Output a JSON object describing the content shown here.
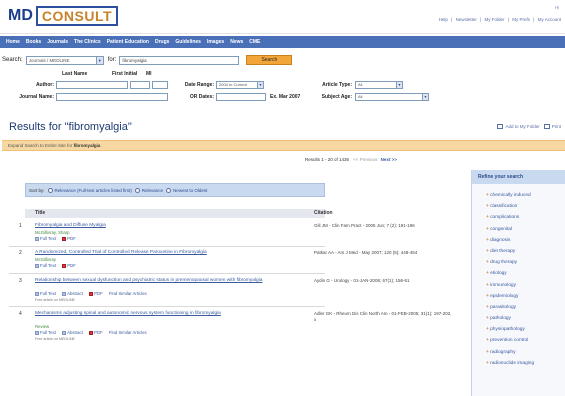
{
  "app": {
    "logo_md": "MD",
    "logo_consult": "CONSULT"
  },
  "header": {
    "hide": "Hi",
    "toplinks": [
      "Help",
      "|",
      "Newsletter",
      "|",
      "My Folder",
      "|",
      "My Prefs",
      "|",
      "My Account"
    ]
  },
  "navbar": {
    "items": [
      "Home",
      "Books",
      "Journals",
      "The Clinics",
      "Patient Education",
      "Drugs",
      "Guidelines",
      "Images",
      "News",
      "CME"
    ]
  },
  "search": {
    "label": "Search:",
    "scope": "Journals / MEDLINE",
    "for_label": "for:",
    "query": "fibromyalgia",
    "button": "Search"
  },
  "advanced": {
    "last_name": "Last Name",
    "first_initial": "First Initial",
    "mi": "MI",
    "author": "Author:",
    "journal_name": "Journal Name:",
    "date_range": "Date Range:",
    "date_range_value": "2004 to Current",
    "or_dates": "OR Dates:",
    "ex_date": "Ex. Mar 2007",
    "article_type": "Article Type:",
    "article_type_value": "All",
    "subject_age": "Subject Age:",
    "subject_age_value": "All"
  },
  "results": {
    "title": "Results for \"fibromyalgia\"",
    "tools": [
      "Add to My Folder",
      "Print"
    ],
    "expand_text": "Expand Search to Entire Site for",
    "expand_term": "fibromyalgia",
    "pager": {
      "range": "Results 1 - 20 of 1436",
      "prev": "<< Previous",
      "next": "Next >>"
    },
    "sort": {
      "label": "Sort by:",
      "options": [
        "Relevance (Full-text articles listed first)",
        "Relevance",
        "Newest to Oldest"
      ]
    },
    "columns": {
      "title": "Title",
      "citation": "Citation"
    },
    "rows": [
      {
        "num": "1",
        "title": "Fibromyalgia and Diffuse Myalgia",
        "authors": "McGillivray, Sharp",
        "links": [
          "Full Text",
          "PDF"
        ],
        "small": "",
        "citation": "Gill JM - Clin Fam Pract - 2005 Jun; 7 (2); 191-196"
      },
      {
        "num": "2",
        "title": "A Randomized, Controlled Trial of Controlled Release Paroxetine in Fibromyalgia",
        "authors": "McGillivray",
        "links": [
          "Full Text",
          "PDF"
        ],
        "small": "",
        "citation": "Patkar AA - Am J Med - May 2007; 120 (5); 448-454"
      },
      {
        "num": "3",
        "title": "Relationship between sexual dysfunction and psychiatric status in premenopausal women with fibromyalgia",
        "authors": "",
        "links": [
          "Full Text",
          "Abstract",
          "PDF",
          "Find Similar Articles"
        ],
        "small": "Free article on MEDLINE",
        "citation": "Aydin G - Urology - 01-JAN-2006; 67(1); 156-61"
      },
      {
        "num": "4",
        "title": "Mechanisms adjusting spinal and autonomic nervous system functioning in fibromyalgia",
        "authors": "Review",
        "links": [
          "Full Text",
          "Abstract",
          "PDF",
          "Find Similar Articles"
        ],
        "small": "Free article on MEDLINE",
        "citation": "Adler GK - Rheum Dis Clin North Am - 01-FEB-2005; 31(1); 197-202, x"
      }
    ]
  },
  "sidebar": {
    "title": "Refine your search",
    "items": [
      "chemically induced",
      "classification",
      "complications",
      "congenital",
      "diagnosis",
      "diet therapy",
      "drug therapy",
      "etiology",
      "immunology",
      "epidemiology",
      "parasitology",
      "pathology",
      "physiopathology",
      "prevention control",
      "radiography",
      "radionuclide imaging"
    ]
  },
  "colors": {
    "navbar": "#4a70b8",
    "accent": "#f2a63a",
    "expand_bar": "#f7d8a3",
    "link": "#3a5aa0"
  }
}
